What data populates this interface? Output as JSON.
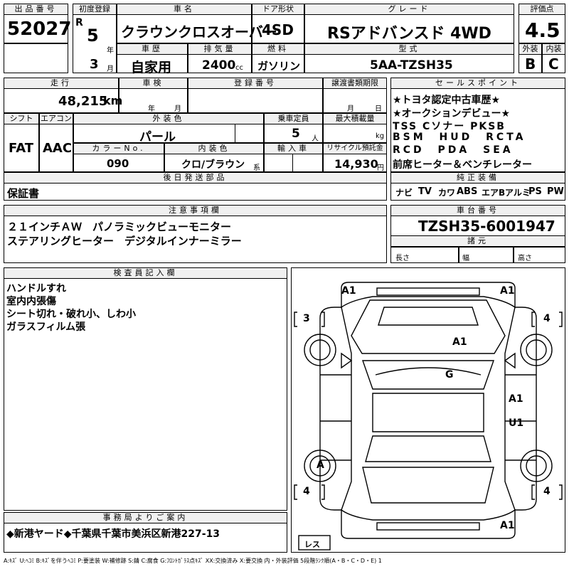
{
  "header": {
    "lot_label": "出品番号",
    "lot": "52027",
    "first_reg_label": "初度登録",
    "era": "R",
    "year": "5",
    "year_unit": "年",
    "month": "3",
    "month_unit": "月",
    "name_label": "車名",
    "name": "クラウンクロスオーバー",
    "door_label": "ドア形状",
    "door": "4SD",
    "grade_label": "グレード",
    "grade": "RSアドバンスド 4WD",
    "score_label": "評価点",
    "score": "4.5",
    "history_label": "車歴",
    "history": "自家用",
    "displacement_label": "排気量",
    "displacement": "2400",
    "displacement_unit": "cc",
    "fuel_label": "燃料",
    "fuel": "ガソリン",
    "model_label": "型式",
    "model": "5AA-TZSH35",
    "exterior_label": "外装",
    "exterior": "B",
    "interior_label": "内装",
    "interior": "C"
  },
  "row2": {
    "mileage_label": "走行",
    "mileage": "48,215",
    "mileage_unit": "km",
    "inspection_label": "車検",
    "insp_year_unit": "年",
    "insp_month_unit": "月",
    "plate_label": "登録番号",
    "transfer_label": "譲渡書類期限",
    "transfer_month_unit": "月",
    "transfer_day_unit": "日",
    "shift_label": "シフト",
    "shift": "FAT",
    "ac_label": "エアコン",
    "ac": "AAC",
    "color_label": "外装色",
    "color": "パール",
    "capacity_label": "乗車定員",
    "capacity": "5",
    "capacity_unit": "人",
    "load_label": "最大積載量",
    "load_unit": "kg",
    "color_no_label": "カラーNo.",
    "color_no": "090",
    "int_color_label": "内装色",
    "int_color": "クロ/ブラウン",
    "int_color_unit": "系",
    "import_label": "輸入車",
    "recycle_label": "リサイクル預託金",
    "recycle": "14,930",
    "recycle_unit": "円",
    "later_parts_label": "後日発送部品",
    "later_parts": "保証書"
  },
  "sales_points": {
    "label": "セールスポイント",
    "lines": [
      "★トヨタ認定中古車歴★",
      "★オークションデビュー★",
      "TSS Cソナー PKSB",
      "BSM HUD RCTA",
      "RCD PDA SEA",
      "前席ヒーター＆ベンチレーター"
    ]
  },
  "equipment": {
    "label": "純正装備",
    "items": [
      "ナビ",
      "TV",
      "カワ",
      "ABS",
      "エアB",
      "アルミ",
      "PS",
      "PW"
    ]
  },
  "notes": {
    "label": "注意事項欄",
    "lines": [
      "２１インチＡＷ　パノラミックビューモニター",
      "ステアリングヒーター　デジタルインナーミラー"
    ]
  },
  "chassis": {
    "label": "車台番号",
    "value": "TZSH35-6001947",
    "dims_label": "諸元",
    "length_label": "長さ",
    "width_label": "幅",
    "height_label": "高さ"
  },
  "inspector": {
    "label": "検査員記入欄",
    "lines": [
      "ハンドルすれ",
      "室内内張傷",
      "シート切れ・破れ小、しわ小",
      "ガラスフィルム張"
    ]
  },
  "office": {
    "label": "事務局よりご案内",
    "text": "◆新港ヤード◆千葉県千葉市美浜区新港227-13"
  },
  "diagram": {
    "marks": {
      "front_left": "A1",
      "front_right": "A1",
      "tire_fl": "3",
      "tire_fr": "4",
      "tire_rl": "4",
      "tire_rr": "4",
      "hood": "A1",
      "windshield": "G",
      "right_front_door": "A1",
      "right_rear_door": "U1",
      "left_front_wheel": "A",
      "rear": "A1",
      "spare": "レス"
    }
  },
  "legend": "A:ｷｽﾞ U:ﾍｺﾐ B:ｷｽﾞを伴うﾍｺﾐ P:要塗装 W:補修跡 S:錆 C:腐食 G:ﾌﾛﾝﾄｶﾞﾗｽ点ｷｽﾞ XX:交換済み X:要交換  内・外装評価 5段階ﾗﾝｸ順(A・B・C・D・E) 1"
}
